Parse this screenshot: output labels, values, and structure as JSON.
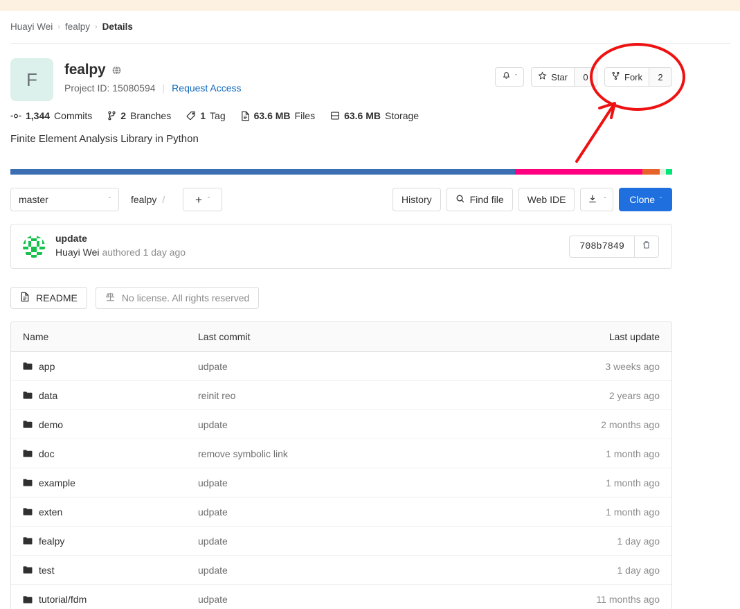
{
  "breadcrumb": {
    "items": [
      {
        "label": "Huayi Wei"
      },
      {
        "label": "fealpy"
      },
      {
        "label": "Details"
      }
    ],
    "separator": "›"
  },
  "project": {
    "avatar_letter": "F",
    "name": "fealpy",
    "visibility_icon": "globe-icon",
    "project_id_label": "Project ID: 15080594",
    "divider": "|",
    "request_access_label": "Request Access",
    "description": "Finite Element Analysis Library in Python",
    "avatar_bg": "#dcf0ec"
  },
  "actions": {
    "notification_icon": "bell-icon",
    "notification_chevron": "ˇ",
    "star_label": "Star",
    "star_count": "0",
    "fork_label": "Fork",
    "fork_count": "2"
  },
  "stats": [
    {
      "icon": "commit-icon",
      "value": "1,344",
      "label": "Commits"
    },
    {
      "icon": "branch-icon",
      "value": "2",
      "label": "Branches"
    },
    {
      "icon": "tag-icon",
      "value": "1",
      "label": "Tag"
    },
    {
      "icon": "file-icon",
      "value": "63.6 MB",
      "label": "Files"
    },
    {
      "icon": "storage-icon",
      "value": "63.6 MB",
      "label": "Storage"
    }
  ],
  "language_bar": [
    {
      "name": "segment-1",
      "color": "#3c6eb4",
      "width_pct": 76.3
    },
    {
      "name": "segment-2",
      "color": "#ff0080",
      "width_pct": 19.2
    },
    {
      "name": "segment-3",
      "color": "#e8622b",
      "width_pct": 2.6
    },
    {
      "name": "segment-4",
      "color": "#e0f0e0",
      "width_pct": 1.0
    },
    {
      "name": "segment-5",
      "color": "#00e676",
      "width_pct": 0.9
    }
  ],
  "toolbar": {
    "branch": "master",
    "branch_chevron": "ˇ",
    "path_root": "fealpy",
    "path_separator": "/",
    "plus_label": "+",
    "plus_chevron": "ˇ",
    "history_label": "History",
    "find_file_label": "Find file",
    "find_file_icon": "search-icon",
    "web_ide_label": "Web IDE",
    "download_icon": "download-icon",
    "download_chevron": "ˇ",
    "clone_label": "Clone",
    "clone_chevron": "ˇ",
    "clone_color": "#1f6fde"
  },
  "commit": {
    "title": "update",
    "author": "Huayi Wei",
    "meta_suffix": "authored 1 day ago",
    "sha": "708b7849",
    "copy_icon": "clipboard-icon"
  },
  "meta_buttons": {
    "readme_label": "README",
    "readme_icon": "document-icon",
    "license_label": "No license. All rights reserved",
    "license_icon": "scale-icon"
  },
  "file_table": {
    "columns": {
      "name": "Name",
      "last_commit": "Last commit",
      "last_update": "Last update"
    },
    "rows": [
      {
        "icon": "folder-icon",
        "name": "app",
        "last_commit": "udpate",
        "last_update": "3 weeks ago"
      },
      {
        "icon": "folder-icon",
        "name": "data",
        "last_commit": "reinit reo",
        "last_update": "2 years ago"
      },
      {
        "icon": "folder-icon",
        "name": "demo",
        "last_commit": "update",
        "last_update": "2 months ago"
      },
      {
        "icon": "folder-icon",
        "name": "doc",
        "last_commit": "remove symbolic link",
        "last_update": "1 month ago"
      },
      {
        "icon": "folder-icon",
        "name": "example",
        "last_commit": "udpate",
        "last_update": "1 month ago"
      },
      {
        "icon": "folder-icon",
        "name": "exten",
        "last_commit": "udpate",
        "last_update": "1 month ago"
      },
      {
        "icon": "folder-icon",
        "name": "fealpy",
        "last_commit": "update",
        "last_update": "1 day ago"
      },
      {
        "icon": "folder-icon",
        "name": "test",
        "last_commit": "update",
        "last_update": "1 day ago"
      },
      {
        "icon": "folder-icon",
        "name": "tutorial/fdm",
        "last_commit": "udpate",
        "last_update": "11 months ago"
      }
    ]
  },
  "annotation": {
    "color": "#ee1111",
    "ellipse_target": "fork-button",
    "arrow_target": "fork-button"
  }
}
